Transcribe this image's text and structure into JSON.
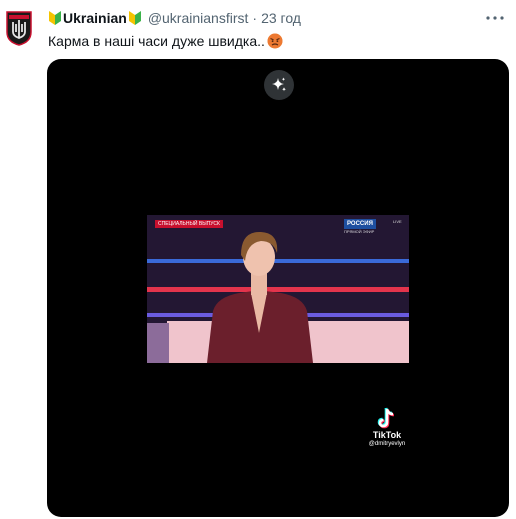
{
  "tweet": {
    "display_name": "Ukrainian",
    "handle": "@ukrainiansfirst",
    "separator": "·",
    "time": "23 год",
    "text": "Карма в наші часи дуже швидка..",
    "emoji_name": "angry-face-icon"
  },
  "video": {
    "broadcast_label": "СПЕЦИАЛЬНЫЙ ВЫПУСК",
    "channel_logo": "РОССИЯ",
    "channel_sub": "ПРЯМОЙ ЭФИР",
    "live_badge": "LIVE",
    "watermark_name": "TikTok",
    "watermark_user": "@dmitryevlyn"
  },
  "colors": {
    "accent_badge": "#f5c400",
    "badge_green": "#3bb34a",
    "media_bg": "#000000",
    "grok_bg": "#2f3336"
  },
  "icons": {
    "avatar": "trident-shield-icon",
    "badge": "beginner-badge-icon",
    "more": "more-dots-icon",
    "grok": "grok-sparkle-icon",
    "tiktok": "tiktok-note-icon"
  }
}
